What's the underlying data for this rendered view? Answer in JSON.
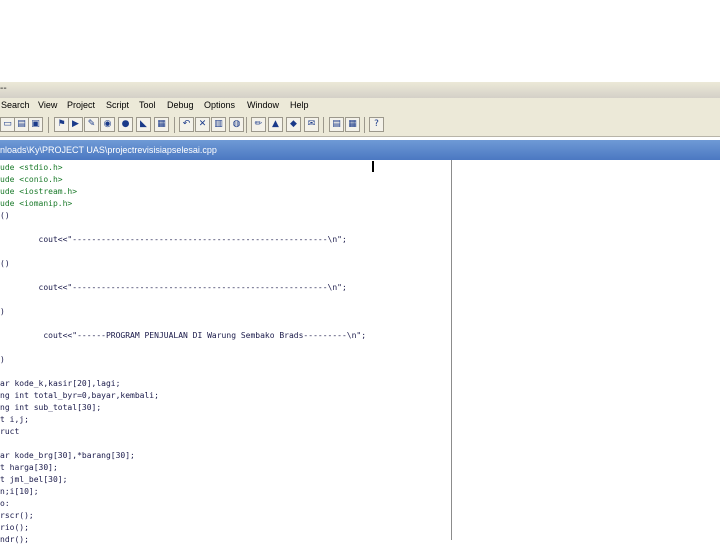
{
  "window": {
    "title": "--"
  },
  "menu": [
    "Search",
    "View",
    "Project",
    "Script",
    "Tool",
    "Debug",
    "Options",
    "Window",
    "Help"
  ],
  "toolbar": {
    "buttons": [
      {
        "name": "new-file-icon",
        "glyph": "▭"
      },
      {
        "name": "open-file-icon",
        "glyph": "▤"
      },
      {
        "name": "save-icon",
        "glyph": "▣"
      },
      {
        "name": "compile-icon",
        "glyph": "⚑"
      },
      {
        "name": "run-icon",
        "glyph": "▶"
      },
      {
        "name": "tool-a-icon",
        "glyph": "✎"
      },
      {
        "name": "tool-b-icon",
        "glyph": "◉"
      },
      {
        "name": "stop-icon",
        "glyph": "●"
      },
      {
        "name": "tool-c-icon",
        "glyph": "◣"
      },
      {
        "name": "tool-d-icon",
        "glyph": "▦"
      },
      {
        "name": "undo-icon",
        "glyph": "↶"
      },
      {
        "name": "cut-icon",
        "glyph": "✕"
      },
      {
        "name": "tool-e-icon",
        "glyph": "▥"
      },
      {
        "name": "tool-f-icon",
        "glyph": "◍"
      },
      {
        "name": "tool-g-icon",
        "glyph": "✏"
      },
      {
        "name": "tool-h-icon",
        "glyph": "▲"
      },
      {
        "name": "tool-i-icon",
        "glyph": "◆"
      },
      {
        "name": "tool-j-icon",
        "glyph": "✉"
      },
      {
        "name": "tool-k-icon",
        "glyph": "▤"
      },
      {
        "name": "tool-l-icon",
        "glyph": "▦"
      },
      {
        "name": "help-icon",
        "glyph": "?"
      }
    ]
  },
  "tab": {
    "path": "nloads\\Ky\\PROJECT UAS\\projectrevisisiapselesai.cpp"
  },
  "code": [
    "ude <stdio.h>",
    "ude <conio.h>",
    "ude <iostream.h>",
    "ude <iomanip.h>",
    "()",
    "",
    "        cout<<\"-----------------------------------------------------\\n\";",
    "",
    "()",
    "",
    "        cout<<\"-----------------------------------------------------\\n\";",
    "",
    ")",
    "",
    "         cout<<\"------PROGRAM PENJUALAN DI Warung Sembako Brads---------\\n\";",
    "",
    ")",
    "",
    "ar kode_k,kasir[20],lagi;",
    "ng int total_byr=0,bayar,kembali;",
    "ng int sub_total[30];",
    "t i,j;",
    "ruct",
    "",
    "ar kode_brg[30],*barang[30];",
    "t harga[30];",
    "t jml_bel[30];",
    "n;i[10];",
    "o:",
    "rscr();",
    "rio();",
    "ndr();"
  ]
}
